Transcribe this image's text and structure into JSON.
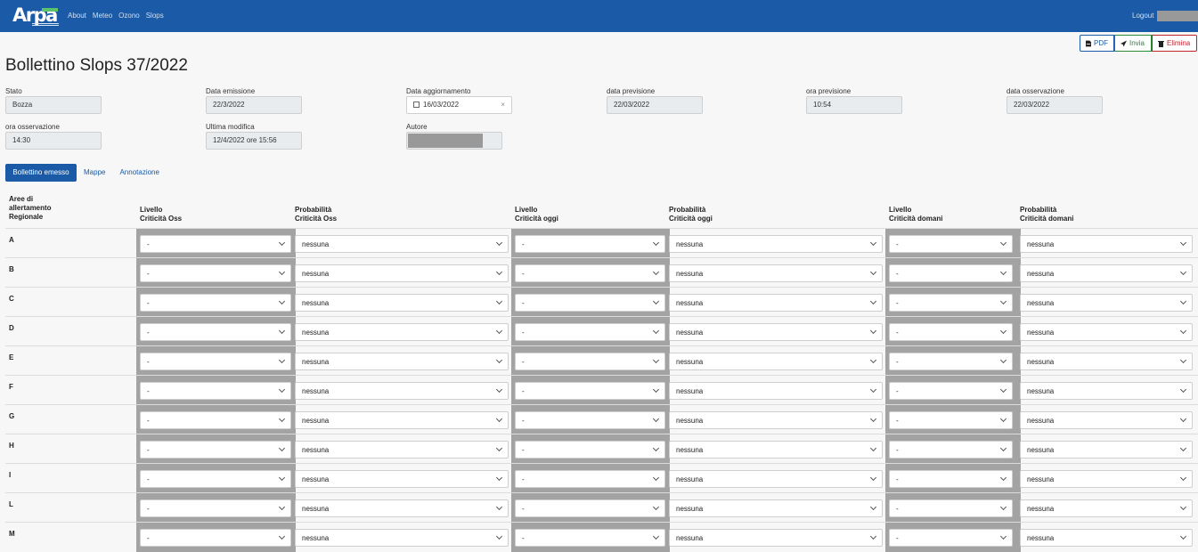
{
  "nav": {
    "logo_text": "Arpa",
    "links": [
      "About",
      "Meteo",
      "Ozono",
      "Slops"
    ],
    "logout": "Logout"
  },
  "actions": {
    "pdf": "PDF",
    "invia": "Invia",
    "elimina": "Elimina"
  },
  "title": "Bollettino Slops 37/2022",
  "fields": {
    "stato": {
      "label": "Stato",
      "value": "Bozza"
    },
    "data_emissione": {
      "label": "Data emissione",
      "value": "22/3/2022"
    },
    "data_aggiornamento": {
      "label": "Data aggiornamento",
      "value": "16/03/2022"
    },
    "data_previsione": {
      "label": "data previsione",
      "value": "22/03/2022"
    },
    "ora_previsione": {
      "label": "ora previsione",
      "value": "10:54"
    },
    "data_osservazione": {
      "label": "data osservazione",
      "value": "22/03/2022"
    },
    "ora_osservazione": {
      "label": "ora osservazione",
      "value": "14:30"
    },
    "ultima_modifica": {
      "label": "Ultima modifica",
      "value": "12/4/2022 ore 15:56"
    },
    "autore": {
      "label": "Autore",
      "value": ""
    }
  },
  "tabs": [
    "Bollettino emesso",
    "Mappe",
    "Annotazione"
  ],
  "table": {
    "headers": {
      "area": [
        "Aree di",
        "allertamento",
        "Regionale"
      ],
      "liv_oss": [
        "Livello",
        "Criticità Oss"
      ],
      "prob_oss": [
        "Probabilità",
        "Criticità Oss"
      ],
      "liv_oggi": [
        "Livello",
        "Criticità oggi"
      ],
      "prob_oggi": [
        "Probabilità",
        "Criticità oggi"
      ],
      "liv_domani": [
        "Livello",
        "Criticità domani"
      ],
      "prob_domani": [
        "Probabilità",
        "Criticità domani"
      ]
    },
    "rows": [
      {
        "area": "A",
        "liv_oss": "-",
        "prob_oss": "nessuna",
        "liv_oggi": "-",
        "prob_oggi": "nessuna",
        "liv_domani": "-",
        "prob_domani": "nessuna"
      },
      {
        "area": "B",
        "liv_oss": "-",
        "prob_oss": "nessuna",
        "liv_oggi": "-",
        "prob_oggi": "nessuna",
        "liv_domani": "-",
        "prob_domani": "nessuna"
      },
      {
        "area": "C",
        "liv_oss": "-",
        "prob_oss": "nessuna",
        "liv_oggi": "-",
        "prob_oggi": "nessuna",
        "liv_domani": "-",
        "prob_domani": "nessuna"
      },
      {
        "area": "D",
        "liv_oss": "-",
        "prob_oss": "nessuna",
        "liv_oggi": "-",
        "prob_oggi": "nessuna",
        "liv_domani": "-",
        "prob_domani": "nessuna"
      },
      {
        "area": "E",
        "liv_oss": "-",
        "prob_oss": "nessuna",
        "liv_oggi": "-",
        "prob_oggi": "nessuna",
        "liv_domani": "-",
        "prob_domani": "nessuna"
      },
      {
        "area": "F",
        "liv_oss": "-",
        "prob_oss": "nessuna",
        "liv_oggi": "-",
        "prob_oggi": "nessuna",
        "liv_domani": "-",
        "prob_domani": "nessuna"
      },
      {
        "area": "G",
        "liv_oss": "-",
        "prob_oss": "nessuna",
        "liv_oggi": "-",
        "prob_oggi": "nessuna",
        "liv_domani": "-",
        "prob_domani": "nessuna"
      },
      {
        "area": "H",
        "liv_oss": "-",
        "prob_oss": "nessuna",
        "liv_oggi": "-",
        "prob_oggi": "nessuna",
        "liv_domani": "-",
        "prob_domani": "nessuna"
      },
      {
        "area": "I",
        "liv_oss": "-",
        "prob_oss": "nessuna",
        "liv_oggi": "-",
        "prob_oggi": "nessuna",
        "liv_domani": "-",
        "prob_domani": "nessuna"
      },
      {
        "area": "L",
        "liv_oss": "-",
        "prob_oss": "nessuna",
        "liv_oggi": "-",
        "prob_oggi": "nessuna",
        "liv_domani": "-",
        "prob_domani": "nessuna"
      },
      {
        "area": "M",
        "liv_oss": "-",
        "prob_oss": "nessuna",
        "liv_oggi": "-",
        "prob_oggi": "nessuna",
        "liv_domani": "-",
        "prob_domani": "nessuna"
      }
    ]
  },
  "colors": {
    "brand": "#1a5aa6",
    "success": "#2a8a3a",
    "danger": "#c0232d",
    "level_cell_bg": "#a3a3a3"
  }
}
